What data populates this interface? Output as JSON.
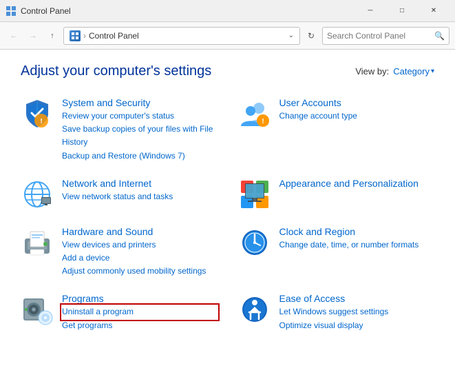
{
  "titlebar": {
    "title": "Control Panel",
    "min_label": "─",
    "max_label": "□",
    "close_label": "✕"
  },
  "addressbar": {
    "back_icon": "←",
    "forward_icon": "→",
    "up_icon": "↑",
    "breadcrumb_icon": "⊞",
    "breadcrumb_sep": "›",
    "breadcrumb_text": "Control Panel",
    "dropdown_icon": "⌄",
    "refresh_icon": "↻",
    "search_placeholder": "Search Control Panel",
    "search_icon": "🔍"
  },
  "main": {
    "page_title": "Adjust your computer's settings",
    "viewby_label": "View by:",
    "viewby_value": "Category",
    "viewby_arrow": "▾",
    "categories": [
      {
        "id": "system-security",
        "title": "System and Security",
        "links": [
          "Review your computer's status",
          "Save backup copies of your files with File History",
          "Backup and Restore (Windows 7)"
        ]
      },
      {
        "id": "user-accounts",
        "title": "User Accounts",
        "links": [
          "Change account type"
        ]
      },
      {
        "id": "network-internet",
        "title": "Network and Internet",
        "links": [
          "View network status and tasks"
        ]
      },
      {
        "id": "appearance",
        "title": "Appearance and Personalization",
        "links": []
      },
      {
        "id": "hardware-sound",
        "title": "Hardware and Sound",
        "links": [
          "View devices and printers",
          "Add a device",
          "Adjust commonly used mobility settings"
        ]
      },
      {
        "id": "clock-region",
        "title": "Clock and Region",
        "links": [
          "Change date, time, or number formats"
        ]
      },
      {
        "id": "programs",
        "title": "Programs",
        "links": [
          "Uninstall a program",
          "Get programs"
        ]
      },
      {
        "id": "ease-access",
        "title": "Ease of Access",
        "links": [
          "Let Windows suggest settings",
          "Optimize visual display"
        ]
      }
    ]
  }
}
